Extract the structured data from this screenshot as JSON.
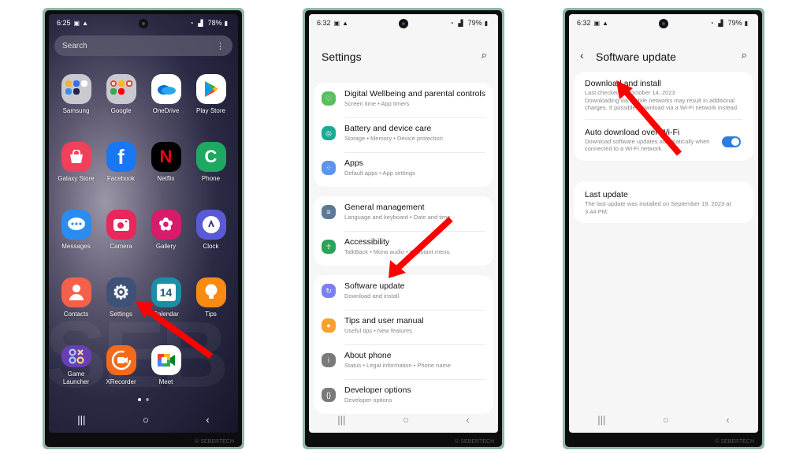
{
  "accent": "#ff0000",
  "phones": {
    "home": {
      "status": {
        "time": "6:25",
        "battery": "78%"
      },
      "search_placeholder": "Search",
      "apps": [
        {
          "label": "Samsung",
          "icon": "samsung-folder-icon",
          "color": "#c9c9d0"
        },
        {
          "label": "Google",
          "icon": "google-folder-icon",
          "color": "#c9c9d0"
        },
        {
          "label": "OneDrive",
          "icon": "onedrive-icon",
          "color": "#ffffff"
        },
        {
          "label": "Play Store",
          "icon": "play-store-icon",
          "color": "#ffffff"
        },
        {
          "label": "Galaxy Store",
          "icon": "galaxy-store-icon",
          "color": "#f2405a"
        },
        {
          "label": "Facebook",
          "icon": "facebook-icon",
          "color": "#1877f2"
        },
        {
          "label": "Netflix",
          "icon": "netflix-icon",
          "color": "#000000"
        },
        {
          "label": "Phone",
          "icon": "phone-icon",
          "color": "#1ea862"
        },
        {
          "label": "Messages",
          "icon": "messages-icon",
          "color": "#2b8cf0"
        },
        {
          "label": "Camera",
          "icon": "camera-icon",
          "color": "#e8285a"
        },
        {
          "label": "Gallery",
          "icon": "gallery-icon",
          "color": "#d81b6a"
        },
        {
          "label": "Clock",
          "icon": "clock-icon",
          "color": "#5a5ad6"
        },
        {
          "label": "Contacts",
          "icon": "contacts-icon",
          "color": "#f5604a"
        },
        {
          "label": "Settings",
          "icon": "settings-icon",
          "color": "#3e5277"
        },
        {
          "label": "Calendar",
          "icon": "calendar-icon",
          "color": "#1a8fa8"
        },
        {
          "label": "Tips",
          "icon": "tips-icon",
          "color": "#f98a12"
        },
        {
          "label": "Game Launcher",
          "icon": "game-launcher-icon",
          "color": "#6a3fb5"
        },
        {
          "label": "XRecorder",
          "icon": "xrecorder-icon",
          "color": "#f56a1a"
        },
        {
          "label": "Meet",
          "icon": "meet-icon",
          "color": "#ffffff"
        }
      ],
      "calendar_day": "14",
      "page_indicator": {
        "current": 1,
        "total": 2
      },
      "watermark": "© SEBERTECH"
    },
    "settings": {
      "status": {
        "time": "6:32",
        "battery": "79%"
      },
      "title": "Settings",
      "groups": [
        [
          {
            "title": "Digital Wellbeing and parental controls",
            "subtitle": "Screen time  •  App timers",
            "icon": "digital-wellbeing-icon",
            "color": "#5bbf62"
          },
          {
            "title": "Battery and device care",
            "subtitle": "Storage  •  Memory  •  Device protection",
            "icon": "battery-device-care-icon",
            "color": "#1aab94"
          },
          {
            "title": "Apps",
            "subtitle": "Default apps  •  App settings",
            "icon": "apps-icon",
            "color": "#5c94f0"
          }
        ],
        [
          {
            "title": "General management",
            "subtitle": "Language and keyboard  •  Date and time",
            "icon": "general-management-icon",
            "color": "#5c7a96"
          },
          {
            "title": "Accessibility",
            "subtitle": "TalkBack  •  Mono audio  •  Assistant menu",
            "icon": "accessibility-icon",
            "color": "#2aa45a"
          }
        ],
        [
          {
            "title": "Software update",
            "subtitle": "Download and install",
            "icon": "software-update-icon",
            "color": "#7b7ff0"
          },
          {
            "title": "Tips and user manual",
            "subtitle": "Useful tips  •  New features",
            "icon": "tips-manual-icon",
            "color": "#f8a030"
          },
          {
            "title": "About phone",
            "subtitle": "Status  •  Legal information  •  Phone name",
            "icon": "about-phone-icon",
            "color": "#7a7a7a"
          },
          {
            "title": "Developer options",
            "subtitle": "Developer options",
            "icon": "developer-options-icon",
            "color": "#7a7a7a"
          }
        ]
      ],
      "watermark": "© SEBERTECH"
    },
    "software_update": {
      "status": {
        "time": "6:32",
        "battery": "79%"
      },
      "title": "Software update",
      "items": [
        {
          "title": "Download and install",
          "subtitle": "Last checked on October 14, 2023",
          "note": "Downloading via mobile networks may result in additional charges. If possible, download via a Wi-Fi network instead."
        },
        {
          "title": "Auto download over Wi-Fi",
          "subtitle": "Download software updates automatically when connected to a Wi-Fi network.",
          "toggle_on": true
        }
      ],
      "last_update": {
        "title": "Last update",
        "subtitle": "The last update was installed on September 19, 2023 at 3:44 PM."
      },
      "watermark": "© SEBERTECH"
    }
  }
}
